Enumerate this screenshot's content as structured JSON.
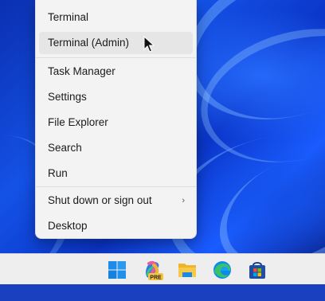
{
  "menu": {
    "items": [
      {
        "label": "Terminal"
      },
      {
        "label": "Terminal (Admin)"
      },
      {
        "label": "Task Manager"
      },
      {
        "label": "Settings"
      },
      {
        "label": "File Explorer"
      },
      {
        "label": "Search"
      },
      {
        "label": "Run"
      },
      {
        "label": "Shut down or sign out"
      },
      {
        "label": "Desktop"
      }
    ],
    "submenu_chevron": "›"
  },
  "taskbar": {
    "icons": [
      "windows-start-icon",
      "copilot-pre-icon",
      "file-explorer-icon",
      "edge-icon",
      "microsoft-store-icon"
    ],
    "copilot_badge": "PRE"
  },
  "colors": {
    "menu_bg": "#f3f3f3",
    "hover_bg": "#e6e6e6",
    "taskbar_bg": "#eeeeee",
    "wallpaper_blue": "#1452e6"
  }
}
